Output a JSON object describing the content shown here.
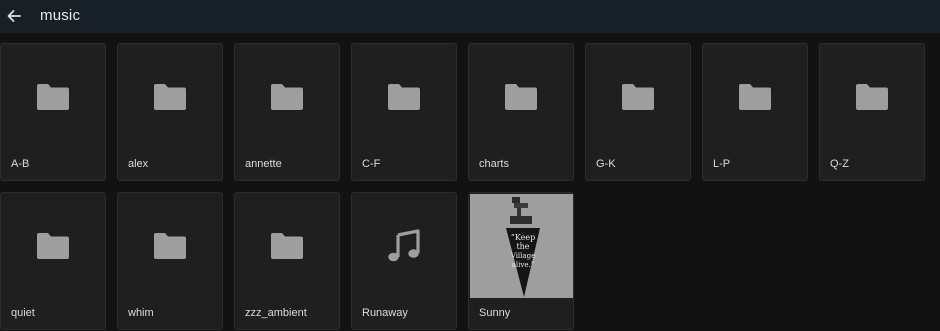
{
  "header": {
    "back_icon": "arrow-left-icon",
    "title": "music"
  },
  "row1": [
    {
      "label": "A-B",
      "icon": "folder-icon"
    },
    {
      "label": "alex",
      "icon": "folder-icon"
    },
    {
      "label": "annette",
      "icon": "folder-icon"
    },
    {
      "label": "C-F",
      "icon": "folder-icon"
    },
    {
      "label": "charts",
      "icon": "folder-icon"
    },
    {
      "label": "G-K",
      "icon": "folder-icon"
    },
    {
      "label": "L-P",
      "icon": "folder-icon"
    },
    {
      "label": "Q-Z",
      "icon": "folder-icon"
    }
  ],
  "row2": [
    {
      "label": "quiet",
      "icon": "folder-icon"
    },
    {
      "label": "whim",
      "icon": "folder-icon"
    },
    {
      "label": "zzz_ambient",
      "icon": "folder-icon"
    },
    {
      "label": "Runaway",
      "icon": "music-note-icon"
    },
    {
      "label": "Sunny",
      "icon": "album-art",
      "art_text": [
        "“Keep",
        "the",
        "Village",
        "alive.”"
      ]
    }
  ],
  "colors": {
    "background": "#121212",
    "topbar": "#172026",
    "tile": "#1f1f1f",
    "icon": "#9e9e9e"
  }
}
